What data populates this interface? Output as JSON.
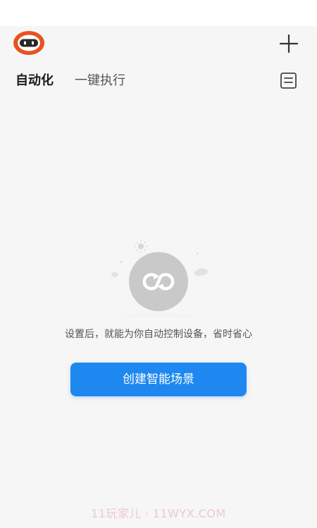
{
  "header": {
    "avatar_icon": "robot-avatar-icon",
    "add_icon": "plus-icon",
    "log_icon": "log-list-icon"
  },
  "tabs": [
    {
      "label": "自动化",
      "active": true
    },
    {
      "label": "一键执行",
      "active": false
    }
  ],
  "empty_state": {
    "illustration_icon": "loop-cloud-illustration-icon",
    "message": "设置后，就能为你自动控制设备，省时省心",
    "button_label": "创建智能场景"
  },
  "watermark": "11玩家儿 · 11WYX.COM",
  "colors": {
    "accent": "#1e88f0",
    "background": "#f6f6f6",
    "avatar": "#e8521e"
  }
}
